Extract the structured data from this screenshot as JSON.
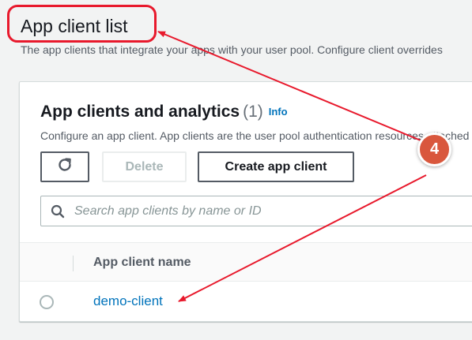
{
  "header": {
    "title": "App client list",
    "description": "The app clients that integrate your apps with your user pool. Configure client overrides"
  },
  "section": {
    "title": "App clients and analytics",
    "count": "(1)",
    "info_label": "Info",
    "description": "Configure an app client. App clients are the user pool authentication resources attached to your app."
  },
  "toolbar": {
    "refresh_icon": "refresh-icon",
    "delete_label": "Delete",
    "create_label": "Create app client"
  },
  "search": {
    "icon": "search-icon",
    "placeholder": "Search app clients by name or ID"
  },
  "table": {
    "columns": [
      "App client name"
    ],
    "rows": [
      {
        "name": "demo-client",
        "selected": false
      }
    ]
  },
  "annotation": {
    "step_number": "4",
    "color": "#e8192c",
    "badge_color": "#d9573d"
  },
  "colors": {
    "link": "#0073bb",
    "text": "#16191f",
    "muted": "#545b64",
    "background": "#f2f3f3"
  }
}
